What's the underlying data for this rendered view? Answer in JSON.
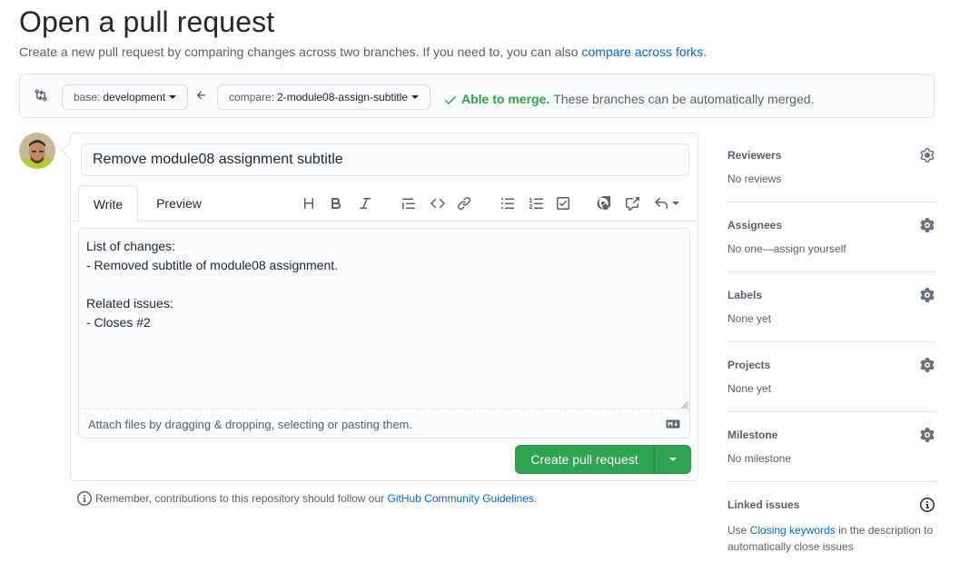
{
  "header": {
    "title": "Open a pull request",
    "subtitle": "Create a new pull request by comparing changes across two branches. If you need to, you can also",
    "subtitle_link": "compare across forks",
    "subtitle_end": "."
  },
  "range": {
    "base_prefix": "base:",
    "base_branch": "development",
    "compare_prefix": "compare:",
    "compare_branch": "2-module08-assign-subtitle",
    "merge_ok": "Able to merge.",
    "merge_msg": "These branches can be automatically merged."
  },
  "form": {
    "title_value": "Remove module08 assignment subtitle",
    "tab_write": "Write",
    "tab_preview": "Preview",
    "body_value": "List of changes:\n- Removed subtitle of module08 assignment.\n\nRelated issues:\n- Closes #2",
    "drop_hint": "Attach files by dragging & dropping, selecting or pasting them.",
    "submit_label": "Create pull request"
  },
  "guidelines": {
    "prefix": "Remember, contributions to this repository should follow our",
    "link": "GitHub Community Guidelines",
    "suffix": "."
  },
  "sidebar": {
    "reviewers": {
      "heading": "Reviewers",
      "value": "No reviews"
    },
    "assignees": {
      "heading": "Assignees",
      "value": "No one—assign yourself"
    },
    "labels": {
      "heading": "Labels",
      "value": "None yet"
    },
    "projects": {
      "heading": "Projects",
      "value": "None yet"
    },
    "milestone": {
      "heading": "Milestone",
      "value": "No milestone"
    },
    "linked": {
      "heading": "Linked issues",
      "desc_prefix": "Use",
      "desc_link": "Closing keywords",
      "desc_suffix": "in the description to automatically close issues"
    }
  },
  "colors": {
    "accent_green": "#2ea44f",
    "link_blue": "#0366d6",
    "merge_green": "#28a745"
  }
}
